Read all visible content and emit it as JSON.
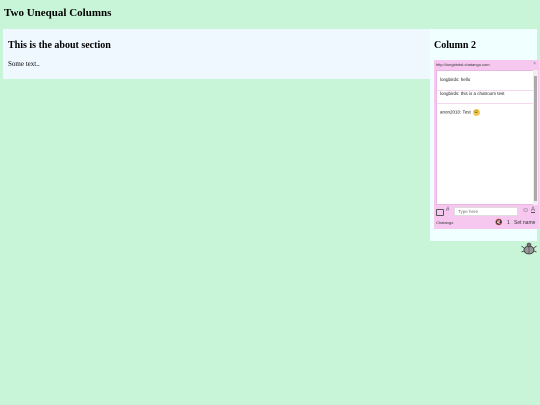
{
  "page": {
    "title": "Two Unequal Columns"
  },
  "about": {
    "heading": "This is the about section",
    "body": "Some text.."
  },
  "column2": {
    "heading": "Column 2"
  },
  "chat": {
    "url": "http://longbirdst.chatango.com",
    "close": "×",
    "messages": [
      {
        "text": "longbirds: hello"
      },
      {
        "text": "longbirds: this is a chatroom test"
      },
      {
        "text": "anon2010: Test"
      }
    ],
    "input_placeholder": "Type here",
    "hash": "#",
    "format_label": "A",
    "brand": "Chatango",
    "user_count": "1",
    "set_name_label": "Set name"
  },
  "colors": {
    "background": "#c8f5d8",
    "about_bg": "#f0f8ff",
    "column2_bg": "#f0ffff",
    "chat_bg": "#f6c8f0"
  },
  "icons": [
    "camera-icon",
    "smiley-icon",
    "speaker-muted-icon",
    "bug-icon"
  ]
}
